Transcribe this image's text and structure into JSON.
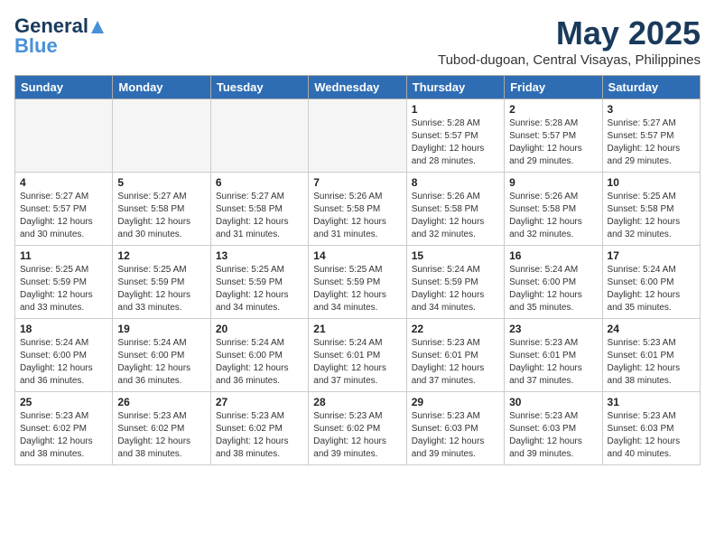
{
  "header": {
    "logo_general": "General",
    "logo_blue": "Blue",
    "month": "May 2025",
    "location": "Tubod-dugoan, Central Visayas, Philippines"
  },
  "weekdays": [
    "Sunday",
    "Monday",
    "Tuesday",
    "Wednesday",
    "Thursday",
    "Friday",
    "Saturday"
  ],
  "weeks": [
    [
      {
        "day": "",
        "info": ""
      },
      {
        "day": "",
        "info": ""
      },
      {
        "day": "",
        "info": ""
      },
      {
        "day": "",
        "info": ""
      },
      {
        "day": "1",
        "info": "Sunrise: 5:28 AM\nSunset: 5:57 PM\nDaylight: 12 hours\nand 28 minutes."
      },
      {
        "day": "2",
        "info": "Sunrise: 5:28 AM\nSunset: 5:57 PM\nDaylight: 12 hours\nand 29 minutes."
      },
      {
        "day": "3",
        "info": "Sunrise: 5:27 AM\nSunset: 5:57 PM\nDaylight: 12 hours\nand 29 minutes."
      }
    ],
    [
      {
        "day": "4",
        "info": "Sunrise: 5:27 AM\nSunset: 5:57 PM\nDaylight: 12 hours\nand 30 minutes."
      },
      {
        "day": "5",
        "info": "Sunrise: 5:27 AM\nSunset: 5:58 PM\nDaylight: 12 hours\nand 30 minutes."
      },
      {
        "day": "6",
        "info": "Sunrise: 5:27 AM\nSunset: 5:58 PM\nDaylight: 12 hours\nand 31 minutes."
      },
      {
        "day": "7",
        "info": "Sunrise: 5:26 AM\nSunset: 5:58 PM\nDaylight: 12 hours\nand 31 minutes."
      },
      {
        "day": "8",
        "info": "Sunrise: 5:26 AM\nSunset: 5:58 PM\nDaylight: 12 hours\nand 32 minutes."
      },
      {
        "day": "9",
        "info": "Sunrise: 5:26 AM\nSunset: 5:58 PM\nDaylight: 12 hours\nand 32 minutes."
      },
      {
        "day": "10",
        "info": "Sunrise: 5:25 AM\nSunset: 5:58 PM\nDaylight: 12 hours\nand 32 minutes."
      }
    ],
    [
      {
        "day": "11",
        "info": "Sunrise: 5:25 AM\nSunset: 5:59 PM\nDaylight: 12 hours\nand 33 minutes."
      },
      {
        "day": "12",
        "info": "Sunrise: 5:25 AM\nSunset: 5:59 PM\nDaylight: 12 hours\nand 33 minutes."
      },
      {
        "day": "13",
        "info": "Sunrise: 5:25 AM\nSunset: 5:59 PM\nDaylight: 12 hours\nand 34 minutes."
      },
      {
        "day": "14",
        "info": "Sunrise: 5:25 AM\nSunset: 5:59 PM\nDaylight: 12 hours\nand 34 minutes."
      },
      {
        "day": "15",
        "info": "Sunrise: 5:24 AM\nSunset: 5:59 PM\nDaylight: 12 hours\nand 34 minutes."
      },
      {
        "day": "16",
        "info": "Sunrise: 5:24 AM\nSunset: 6:00 PM\nDaylight: 12 hours\nand 35 minutes."
      },
      {
        "day": "17",
        "info": "Sunrise: 5:24 AM\nSunset: 6:00 PM\nDaylight: 12 hours\nand 35 minutes."
      }
    ],
    [
      {
        "day": "18",
        "info": "Sunrise: 5:24 AM\nSunset: 6:00 PM\nDaylight: 12 hours\nand 36 minutes."
      },
      {
        "day": "19",
        "info": "Sunrise: 5:24 AM\nSunset: 6:00 PM\nDaylight: 12 hours\nand 36 minutes."
      },
      {
        "day": "20",
        "info": "Sunrise: 5:24 AM\nSunset: 6:00 PM\nDaylight: 12 hours\nand 36 minutes."
      },
      {
        "day": "21",
        "info": "Sunrise: 5:24 AM\nSunset: 6:01 PM\nDaylight: 12 hours\nand 37 minutes."
      },
      {
        "day": "22",
        "info": "Sunrise: 5:23 AM\nSunset: 6:01 PM\nDaylight: 12 hours\nand 37 minutes."
      },
      {
        "day": "23",
        "info": "Sunrise: 5:23 AM\nSunset: 6:01 PM\nDaylight: 12 hours\nand 37 minutes."
      },
      {
        "day": "24",
        "info": "Sunrise: 5:23 AM\nSunset: 6:01 PM\nDaylight: 12 hours\nand 38 minutes."
      }
    ],
    [
      {
        "day": "25",
        "info": "Sunrise: 5:23 AM\nSunset: 6:02 PM\nDaylight: 12 hours\nand 38 minutes."
      },
      {
        "day": "26",
        "info": "Sunrise: 5:23 AM\nSunset: 6:02 PM\nDaylight: 12 hours\nand 38 minutes."
      },
      {
        "day": "27",
        "info": "Sunrise: 5:23 AM\nSunset: 6:02 PM\nDaylight: 12 hours\nand 38 minutes."
      },
      {
        "day": "28",
        "info": "Sunrise: 5:23 AM\nSunset: 6:02 PM\nDaylight: 12 hours\nand 39 minutes."
      },
      {
        "day": "29",
        "info": "Sunrise: 5:23 AM\nSunset: 6:03 PM\nDaylight: 12 hours\nand 39 minutes."
      },
      {
        "day": "30",
        "info": "Sunrise: 5:23 AM\nSunset: 6:03 PM\nDaylight: 12 hours\nand 39 minutes."
      },
      {
        "day": "31",
        "info": "Sunrise: 5:23 AM\nSunset: 6:03 PM\nDaylight: 12 hours\nand 40 minutes."
      }
    ]
  ]
}
